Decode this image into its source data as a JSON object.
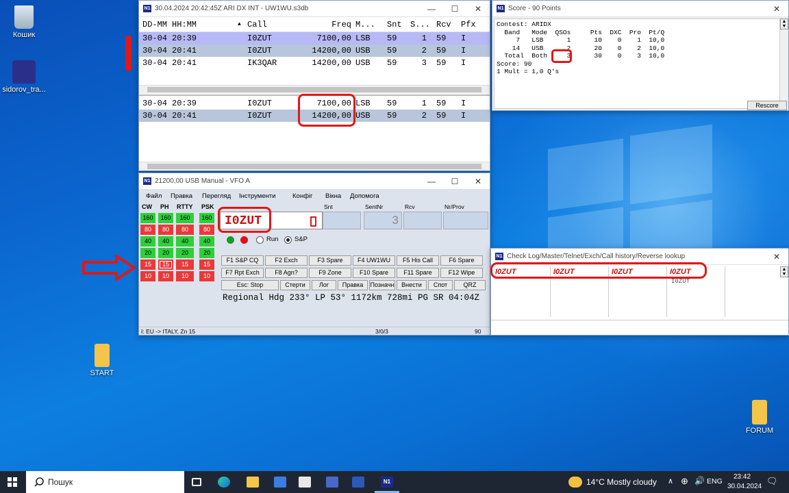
{
  "desktop": {
    "icons": [
      {
        "label": "Кошик"
      },
      {
        "label": "sidorov_tra..."
      },
      {
        "label": "START"
      },
      {
        "label": "FORUM"
      }
    ]
  },
  "log_window": {
    "title": "30.04.2024 20:42:45Z  ARI DX INT - UW1WU.s3db",
    "columns": [
      "DD-MM",
      "HH:MM",
      "Call",
      "Freq",
      "M...",
      "Snt",
      "S...",
      "Rcv",
      "Pfx"
    ],
    "rows": [
      [
        "30-04",
        "20:39",
        "I0ZUT",
        "7100,00",
        "LSB",
        "59",
        "1",
        "59",
        "I"
      ],
      [
        "30-04",
        "20:41",
        "I0ZUT",
        "14200,00",
        "USB",
        "59",
        "2",
        "59",
        "I"
      ],
      [
        "30-04",
        "20:41",
        "IK3QAR",
        "14200,00",
        "USB",
        "59",
        "3",
        "59",
        "I"
      ]
    ],
    "dup_rows": [
      [
        "30-04",
        "20:39",
        "I0ZUT",
        "7100,00",
        "LSB",
        "59",
        "1",
        "59",
        "I"
      ],
      [
        "30-04",
        "20:41",
        "I0ZUT",
        "14200,00",
        "USB",
        "59",
        "2",
        "59",
        "I"
      ]
    ]
  },
  "score_window": {
    "title": "Score - 90 Points",
    "lines": [
      "Contest: ARIDX",
      "  Band   Mode  QSOs     Pts  DXC  Pro  Pt/Q",
      "     7   LSB      1      10    0    1  10,0",
      "    14   USB      2      20    0    2  10,0",
      "  Total  Both     3      30    0    3  10,0",
      "Score: 90",
      "1 Mult = 1,0 Q's"
    ],
    "rescore": "Rescore"
  },
  "entry_window": {
    "title": "21200,00 USB Manual - VFO A",
    "menu": [
      "Файл",
      "Правка",
      "Перегляд",
      "Інструменти",
      "Конфіг",
      "Вікна",
      "Допомога"
    ],
    "modes": [
      "CW",
      "PH",
      "RTTY",
      "PSK"
    ],
    "bands": [
      "160",
      "80",
      "40",
      "20",
      "15",
      "10"
    ],
    "call": "I0ZUT",
    "field_labels": [
      "Snt",
      "SentNr",
      "Rcv",
      "Nr/Prov"
    ],
    "sentnr": "3",
    "radio": [
      "Run",
      "S&P"
    ],
    "fkeys": [
      [
        "F1 S&P CQ",
        "F2 Exch",
        "F3 Spare",
        "F4 UW1WU",
        "F5 His Call",
        "F6 Spare"
      ],
      [
        "F7 Rpt Exch",
        "F8 Agn?",
        "F9 Zone",
        "F10 Spare",
        "F11 Spare",
        "F12 Wipe"
      ],
      [
        "Esc: Stop",
        "Стерти",
        "Лог",
        "Правка",
        "Позначн",
        "Внести",
        "Спот",
        "QRZ"
      ]
    ],
    "info": "Regional Hdg 233° LP 53° 1172km 728mi PG  SR 04:04Z",
    "status": {
      "left": "I: EU -> ITALY, Zn 15",
      "mid": "3/0/3",
      "right": "90"
    }
  },
  "check_window": {
    "title": "Check Log/Master/Telnet/Exch/Call history/Reverse lookup",
    "calls": [
      "I0ZUT",
      "I0ZUT",
      "I0ZUT",
      "I0ZUT"
    ],
    "sub": "I0ZUT"
  },
  "taskbar": {
    "search": "Пошук",
    "weather": "14°C  Mostly cloudy",
    "lang": "ENG",
    "time": "23:42",
    "date": "30.04.2024"
  }
}
